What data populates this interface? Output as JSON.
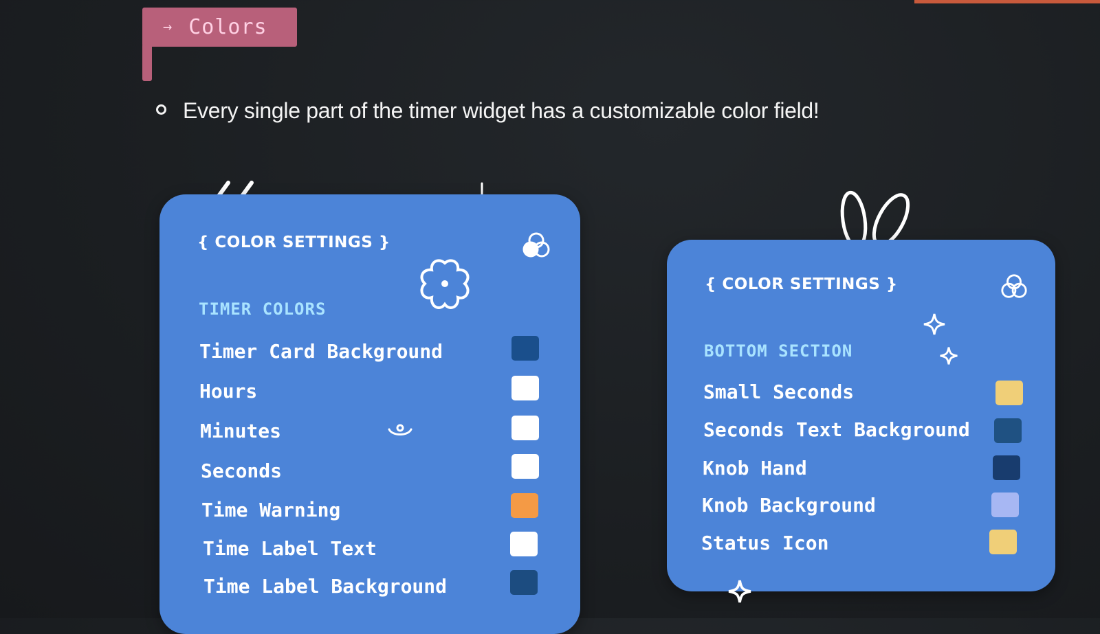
{
  "heading": {
    "arrow": "→",
    "title": "Colors"
  },
  "bullet": "Every single part of the timer widget has a customizable color field!",
  "left_card": {
    "title": "{ COLOR SETTINGS }",
    "section": "TIMER COLORS",
    "rows": [
      {
        "label": "Timer Card Background",
        "color": "#1a4f8c"
      },
      {
        "label": "Hours",
        "color": "#ffffff"
      },
      {
        "label": "Minutes",
        "color": "#ffffff"
      },
      {
        "label": "Seconds",
        "color": "#ffffff"
      },
      {
        "label": "Time Warning",
        "color": "#f49a45"
      },
      {
        "label": "Time Label Text",
        "color": "#ffffff"
      },
      {
        "label": "Time Label Background",
        "color": "#1c4c80"
      }
    ]
  },
  "right_card": {
    "title": "{ COLOR SETTINGS }",
    "section": "BOTTOM SECTION",
    "rows": [
      {
        "label": "Small Seconds",
        "color": "#f0cf78"
      },
      {
        "label": "Seconds Text Background",
        "color": "#1f5182"
      },
      {
        "label": "Knob Hand",
        "color": "#183c6e"
      },
      {
        "label": "Knob Background",
        "color": "#a7b7f3"
      },
      {
        "label": "Status Icon",
        "color": "#f0cf78"
      }
    ]
  },
  "icons": {
    "palette": "palette-icon",
    "flower": "flower-doodle-icon",
    "sparkle": "sparkle-icon",
    "tick_marks": "tick-marks-doodle-icon",
    "bunny_ears": "bunny-ears-doodle-icon",
    "swirl": "swirl-doodle-icon"
  },
  "colors": {
    "card": "#4c84d8",
    "accent_pink": "#b8607a",
    "section_label": "#a9e3ff",
    "background": "#1c1f22"
  }
}
